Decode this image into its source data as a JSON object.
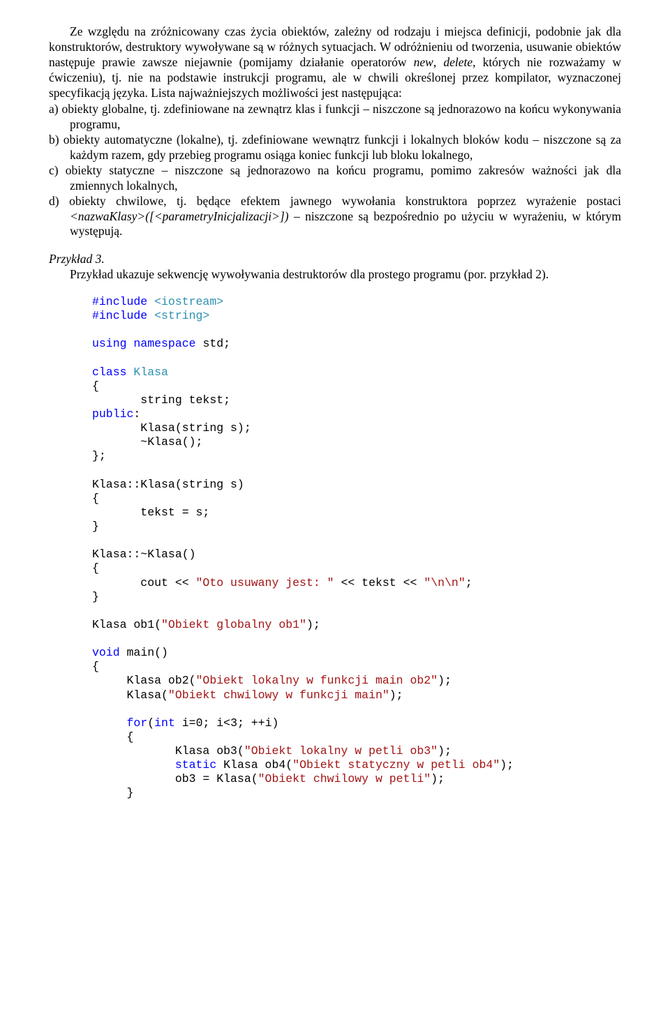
{
  "p1": "Ze względu na zróżnicowany czas życia obiektów, zależny od rodzaju i miejsca definicji, podobnie jak dla konstruktorów, destruktory wywoływane są w różnych sytuacjach. W odróżnieniu od tworzenia, usuwanie obiektów następuje prawie zawsze niejawnie (pomijamy działanie operatorów ",
  "p1_i1": "new",
  "p1_m1": ", ",
  "p1_i2": "delete",
  "p1_m2": ", których nie rozważamy w ćwiczeniu), tj. nie na podstawie instrukcji programu, ale w chwili określonej przez kompilator, wyznaczonej specyfikacją języka. Lista najważniejszych możliwości jest następująca:",
  "li_a": "a)  obiekty globalne, tj. zdefiniowane na zewnątrz klas i funkcji – niszczone są jednorazowo na końcu wykonywania programu,",
  "li_b": "b)  obiekty automatyczne (lokalne), tj. zdefiniowane wewnątrz funkcji i lokalnych bloków kodu – niszczone są za każdym razem, gdy przebieg programu osiąga koniec funkcji lub bloku lokalnego,",
  "li_c": "c)  obiekty statyczne – niszczone są jednorazowo na końcu programu, pomimo zakresów ważności jak dla zmiennych lokalnych,",
  "li_d_1": "d)  obiekty chwilowe, tj. będące efektem jawnego wywołania konstruktora poprzez wyrażenie postaci ",
  "li_d_i": "<nazwaKlasy>([<parametryInicjalizacji>])",
  "li_d_2": " – niszczone są bezpośrednio po użyciu w wyrażeniu, w którym występują.",
  "ex_label": "Przykład 3.",
  "ex_desc": "Przykład ukazuje sekwencję wywoływania destruktorów dla prostego programu (por. przykład 2).",
  "code_tokens": [
    [
      "blue",
      "#include"
    ],
    [
      "teal",
      " <iostream>"
    ],
    [
      "nl",
      ""
    ],
    [
      "blue",
      "#include"
    ],
    [
      "teal",
      " <string>"
    ],
    [
      "nl",
      ""
    ],
    [
      "nl",
      ""
    ],
    [
      "blue",
      "using"
    ],
    [
      "blk",
      " "
    ],
    [
      "blue",
      "namespace"
    ],
    [
      "blk",
      " std;"
    ],
    [
      "nl",
      ""
    ],
    [
      "nl",
      ""
    ],
    [
      "blue",
      "class"
    ],
    [
      "blk",
      " "
    ],
    [
      "teal",
      "Klasa"
    ],
    [
      "nl",
      ""
    ],
    [
      "blk",
      "{"
    ],
    [
      "nl",
      ""
    ],
    [
      "blk",
      "       string tekst;"
    ],
    [
      "nl",
      ""
    ],
    [
      "blue",
      "public"
    ],
    [
      "blk",
      ":"
    ],
    [
      "nl",
      ""
    ],
    [
      "blk",
      "       Klasa(string s);"
    ],
    [
      "nl",
      ""
    ],
    [
      "blk",
      "       ~Klasa();"
    ],
    [
      "nl",
      ""
    ],
    [
      "blk",
      "};"
    ],
    [
      "nl",
      ""
    ],
    [
      "nl",
      ""
    ],
    [
      "blk",
      "Klasa::Klasa(string s)"
    ],
    [
      "nl",
      ""
    ],
    [
      "blk",
      "{"
    ],
    [
      "nl",
      ""
    ],
    [
      "blk",
      "       tekst = s;"
    ],
    [
      "nl",
      ""
    ],
    [
      "blk",
      "}"
    ],
    [
      "nl",
      ""
    ],
    [
      "nl",
      ""
    ],
    [
      "blk",
      "Klasa::~Klasa()"
    ],
    [
      "nl",
      ""
    ],
    [
      "blk",
      "{"
    ],
    [
      "nl",
      ""
    ],
    [
      "blk",
      "       cout << "
    ],
    [
      "str",
      "\"Oto usuwany jest: \""
    ],
    [
      "blk",
      " << tekst << "
    ],
    [
      "str",
      "\"\\n\\n\""
    ],
    [
      "blk",
      ";"
    ],
    [
      "nl",
      ""
    ],
    [
      "blk",
      "}"
    ],
    [
      "nl",
      ""
    ],
    [
      "nl",
      ""
    ],
    [
      "blk",
      "Klasa ob1("
    ],
    [
      "str",
      "\"Obiekt globalny ob1\""
    ],
    [
      "blk",
      ");"
    ],
    [
      "nl",
      ""
    ],
    [
      "nl",
      ""
    ],
    [
      "blue",
      "void"
    ],
    [
      "blk",
      " main()"
    ],
    [
      "nl",
      ""
    ],
    [
      "blk",
      "{"
    ],
    [
      "nl",
      ""
    ],
    [
      "blk",
      "     Klasa ob2("
    ],
    [
      "str",
      "\"Obiekt lokalny w funkcji main ob2\""
    ],
    [
      "blk",
      ");"
    ],
    [
      "nl",
      ""
    ],
    [
      "blk",
      "     Klasa("
    ],
    [
      "str",
      "\"Obiekt chwilowy w funkcji main\""
    ],
    [
      "blk",
      ");"
    ],
    [
      "nl",
      ""
    ],
    [
      "nl",
      ""
    ],
    [
      "blk",
      "     "
    ],
    [
      "blue",
      "for"
    ],
    [
      "blk",
      "("
    ],
    [
      "blue",
      "int"
    ],
    [
      "blk",
      " i=0; i<3; ++i)"
    ],
    [
      "nl",
      ""
    ],
    [
      "blk",
      "     {"
    ],
    [
      "nl",
      ""
    ],
    [
      "blk",
      "            Klasa ob3("
    ],
    [
      "str",
      "\"Obiekt lokalny w petli ob3\""
    ],
    [
      "blk",
      ");"
    ],
    [
      "nl",
      ""
    ],
    [
      "blk",
      "            "
    ],
    [
      "blue",
      "static"
    ],
    [
      "blk",
      " Klasa ob4("
    ],
    [
      "str",
      "\"Obiekt statyczny w petli ob4\""
    ],
    [
      "blk",
      ");"
    ],
    [
      "nl",
      ""
    ],
    [
      "blk",
      "            ob3 = Klasa("
    ],
    [
      "str",
      "\"Obiekt chwilowy w petli\""
    ],
    [
      "blk",
      ");"
    ],
    [
      "nl",
      ""
    ],
    [
      "blk",
      "     }"
    ]
  ]
}
